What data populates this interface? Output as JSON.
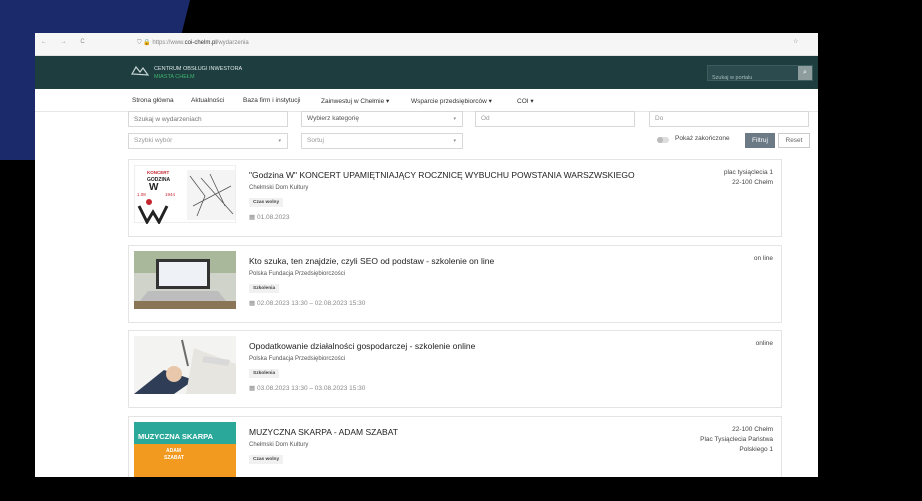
{
  "browser": {
    "nav_icons": "← → C",
    "url_prefix": "https://www.",
    "url_domain": "coi-chelm.pl",
    "url_path": "/wydarzenia",
    "star_icon": "☆"
  },
  "site": {
    "brand_name": "CENTRUM OBSŁUGI INWESTORA",
    "brand_sub": "MIASTA CHEŁM",
    "search_placeholder": "Szukaj w portalu",
    "search_icon": "search-icon"
  },
  "menu": {
    "items": [
      "Strona główna",
      "Aktualności",
      "Baza firm i instytucji",
      "Zainwestuj w Chełmie ▾",
      "Wsparcie przedsiębiorców ▾",
      "COI ▾"
    ]
  },
  "filters": {
    "search_placeholder": "Szukaj w wydarzeniach",
    "category": "Wybierz kategorię",
    "from": "Od",
    "to": "Do",
    "quick": "Szybki wybór",
    "sort": "Sortuj",
    "toggle_label": "Pokaż zakończone",
    "filter_button": "Filtruj",
    "reset_button": "Reset"
  },
  "events": [
    {
      "title": "\"Godzina W\" KONCERT UPAMIĘTNIAJĄCY ROCZNICĘ WYBUCHU POWSTANIA WARSZWSKIEGO",
      "organizer": "Chełmski Dom Kultury",
      "badge": "Czas wolny",
      "date": "01.08.2023",
      "location": [
        "plac tysiąclecia 1",
        "22-100 Chełm"
      ],
      "thumb_lines": [
        "KONCERT",
        "GODZINA",
        "1.08",
        "W",
        "1944"
      ]
    },
    {
      "title": "Kto szuka, ten znajdzie, czyli SEO od podstaw - szkolenie on line",
      "organizer": "Polska Fundacja Przedsiębiorczości",
      "badge": "Szkolenia",
      "date": "02.08.2023 13:30 – 02.08.2023 15:30",
      "location": [
        "on line"
      ]
    },
    {
      "title": "Opodatkowanie działalności gospodarczej - szkolenie online",
      "organizer": "Polska Fundacja Przedsiębiorczości",
      "badge": "Szkolenia",
      "date": "03.08.2023 13:30 – 03.08.2023 15:30",
      "location": [
        "online"
      ]
    },
    {
      "title": "MUZYCZNA SKARPA - ADAM SZABAT",
      "organizer": "Chełmski Dom Kultury",
      "badge": "Czas wolny",
      "date": "",
      "location": [
        "22-100 Chełm",
        "Plac Tysiąclecia Państwa",
        "Polskiego 1"
      ],
      "thumb_lines": [
        "MUZYCZNA SKARPA",
        "ADAM",
        "SZABAT"
      ]
    }
  ],
  "colors": {
    "header_bg": "#1d3d3f",
    "accent_green": "#3fb56c",
    "filter_button_bg": "#6c7a86",
    "corner_blue": "#1b2a6b"
  }
}
